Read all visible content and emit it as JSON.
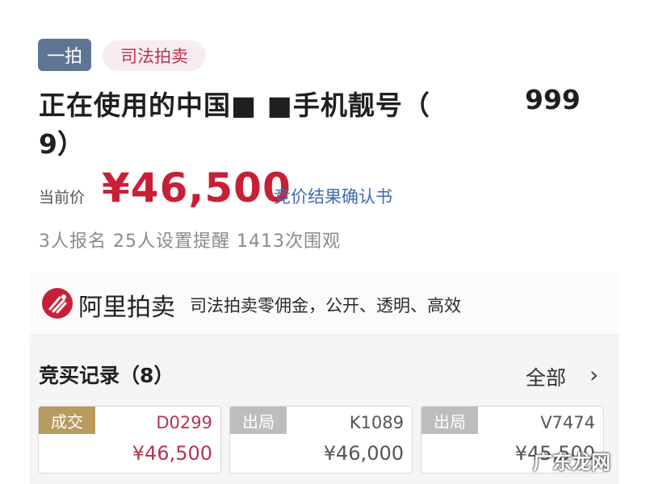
{
  "tags": {
    "round": "一拍",
    "category": "司法拍卖"
  },
  "title": {
    "line1": "正在使用的中国■ ■手机靓号（",
    "number": "999",
    "line2": "9）"
  },
  "price": {
    "label": "当前价",
    "value": "¥46,500",
    "link": "竞价结果确认书"
  },
  "stats": "3人报名  25人设置提醒  1413次围观",
  "banner": {
    "brand": "阿里拍卖",
    "slogan": "司法拍卖零佣金，公开、透明、高效"
  },
  "records": {
    "title": "竞买记录（8）",
    "all_label": "全部",
    "items": [
      {
        "status": "成交",
        "code": "D0299",
        "amount": "¥46,500"
      },
      {
        "status": "出局",
        "code": "K1089",
        "amount": "¥46,000"
      },
      {
        "status": "出局",
        "code": "V7474",
        "amount": "¥45,500"
      }
    ]
  },
  "colors": {
    "accent_red": "#c81f37",
    "badge_won": "#b99a5f",
    "badge_out": "#bdbdbd",
    "link_blue": "#3f6bb3"
  },
  "watermark": "广东龙网"
}
